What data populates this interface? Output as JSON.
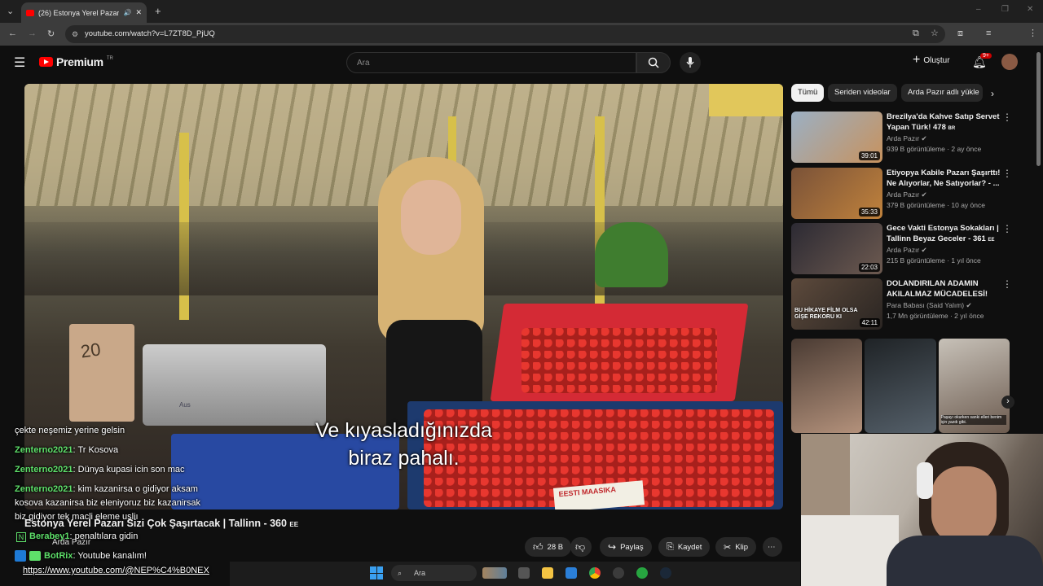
{
  "browser": {
    "tab_title": "(26) Estonya Yerel Pazarı Si...",
    "url": "youtube.com/watch?v=L7ZT8D_PjUQ"
  },
  "header": {
    "logo_text": "Premium",
    "logo_region": "TR",
    "search_placeholder": "Ara",
    "create_label": "Oluştur",
    "notifications_badge": "9+"
  },
  "video": {
    "subtitle_line1": "Ve kıyasladığınızda",
    "subtitle_line2": "biraz pahalı.",
    "scale_label": "Aus",
    "sign_text": "EESTI MAASIKA",
    "price_sign": "20",
    "title": "Estonya Yerel Pazarı Sizi Çok Şaşırtacak | Tallinn - 360",
    "title_suffix": "EE",
    "channel": "Arda Pazır",
    "like_count": "28 B",
    "share_label": "Paylaş",
    "save_label": "Kaydet",
    "clip_label": "Klip"
  },
  "chat": [
    {
      "user": "",
      "text": "çekte neşemiz yerine gelsin"
    },
    {
      "user": "Zenterno2021",
      "text": ": Tr Kosova"
    },
    {
      "user": "Zenterno2021",
      "text": ": Dünya kupasi icin son mac"
    },
    {
      "user": "Zenterno2021",
      "text": ": kim kazanirsa o gidiyor aksam"
    },
    {
      "user": "",
      "text": "kosova kazanirsa biz eleniyoruz biz kazanirsak"
    },
    {
      "user": "",
      "text": "biz gidiyor tek macli eleme usliı"
    },
    {
      "user": "Berabey1",
      "text": ": penaltılara gidin"
    },
    {
      "user": "BotRix",
      "text": ": Youtube kanalım!"
    },
    {
      "user": "",
      "text": "https://www.youtube.com/@NEP%C4%B0NEX"
    }
  ],
  "sidebar": {
    "chips": [
      "Tümü",
      "Seriden videolar",
      "Arda Pazır adlı yükle"
    ],
    "recommendations": [
      {
        "title": "Brezilya'da Kahve Satıp Servet Yapan Türk! 478",
        "flag": "BR",
        "channel": "Arda Pazır",
        "meta": "939 B görüntüleme · 2 ay önce",
        "duration": "39:01"
      },
      {
        "title": "Etiyopya Kabile Pazarı Şaşırttı! Ne Alıyorlar, Ne Satıyorlar? - ...",
        "flag": "",
        "channel": "Arda Pazır",
        "meta": "379 B görüntüleme · 10 ay önce",
        "duration": "35:33"
      },
      {
        "title": "Gece Vakti Estonya Sokakları | Tallinn Beyaz Geceler - 361",
        "flag": "EE",
        "channel": "Arda Pazır",
        "meta": "215 B görüntüleme · 1 yıl önce",
        "duration": "22:03"
      },
      {
        "title": "DOLANDIRILAN ADAMIN AKILALMAZ MÜCADELESİ!",
        "flag": "",
        "channel": "Para Babası (Said Yalım)",
        "meta": "1,7 Mn görüntüleme · 2 yıl önce",
        "duration": "42:11"
      }
    ],
    "thumb4_overlay": "BU HİKAYE FİLM OLSA GİŞE REKORU KI",
    "shorts_caption": "Paşayı okurken sanki elleri benim için yazdı gibi."
  },
  "taskbar": {
    "search_label": "Ara"
  }
}
